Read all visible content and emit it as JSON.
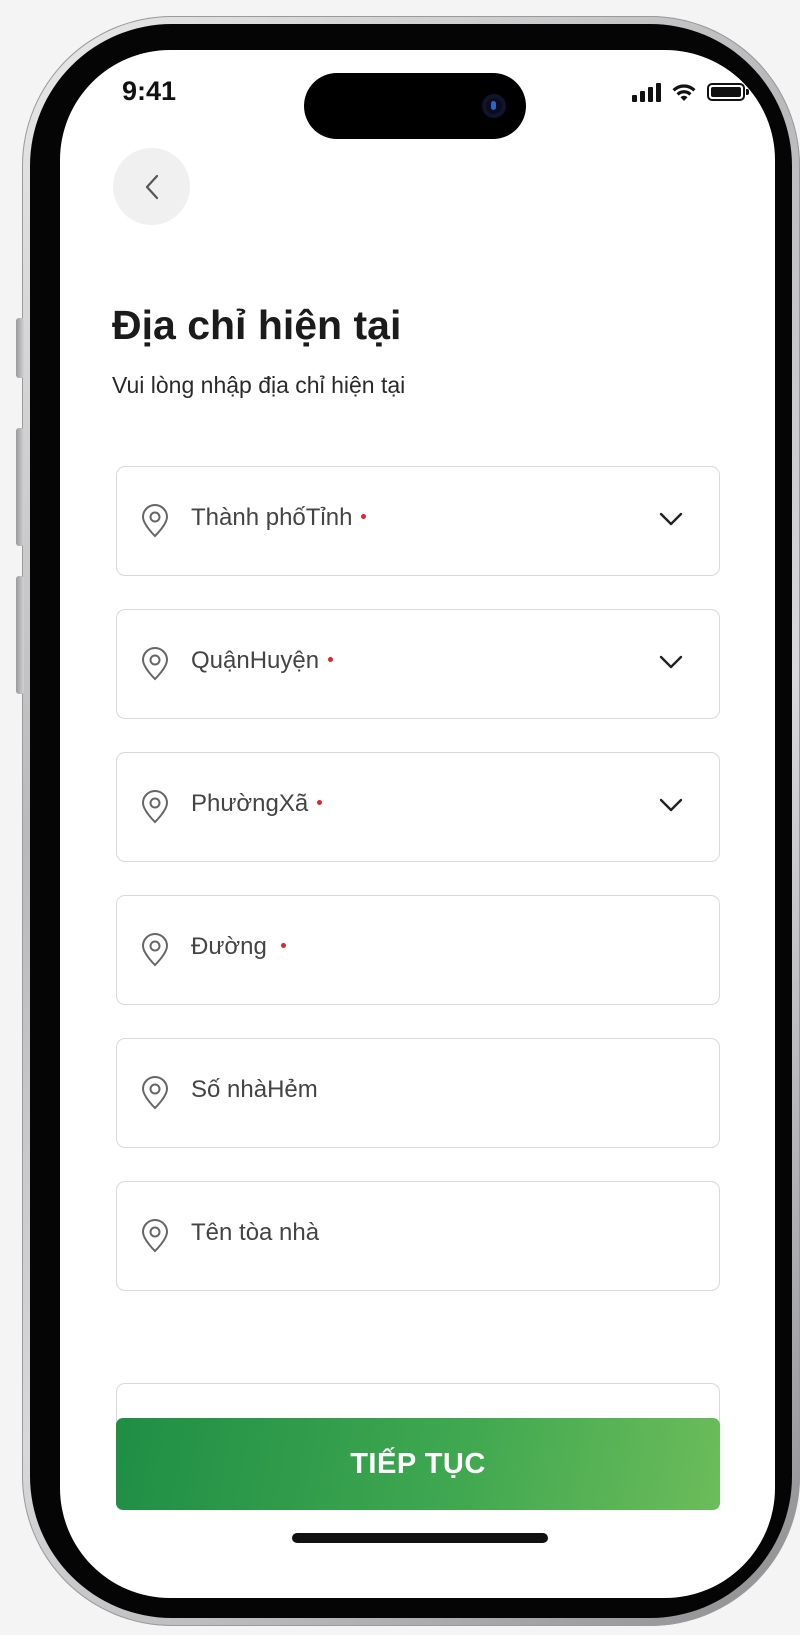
{
  "status_bar": {
    "time": "9:41",
    "icons": [
      "cellular-signal-icon",
      "wifi-icon",
      "battery-icon"
    ]
  },
  "header": {
    "back_icon": "chevron-left-icon",
    "title": "Địa chỉ hiện tại",
    "subtitle": "Vui lòng nhập địa chỉ hiện tại"
  },
  "form": {
    "fields": [
      {
        "label": "Thành phốTỉnh",
        "required": true,
        "dropdown": true,
        "icon": "location-pin-icon"
      },
      {
        "label": "QuậnHuyện",
        "required": true,
        "dropdown": true,
        "icon": "location-pin-icon"
      },
      {
        "label": "PhườngXã",
        "required": true,
        "dropdown": true,
        "icon": "location-pin-icon"
      },
      {
        "label": "Đường",
        "required": true,
        "dropdown": false,
        "icon": "location-pin-icon"
      },
      {
        "label": "Số nhàHẻm",
        "required": false,
        "dropdown": false,
        "icon": "location-pin-icon"
      },
      {
        "label": "Tên tòa nhà",
        "required": false,
        "dropdown": false,
        "icon": "location-pin-icon"
      }
    ]
  },
  "actions": {
    "continue_label": "TIẾP TỤC"
  },
  "colors": {
    "primary_green": "#2e9a4b",
    "required_dot": "#e0262b",
    "border": "#d9d9d9"
  }
}
